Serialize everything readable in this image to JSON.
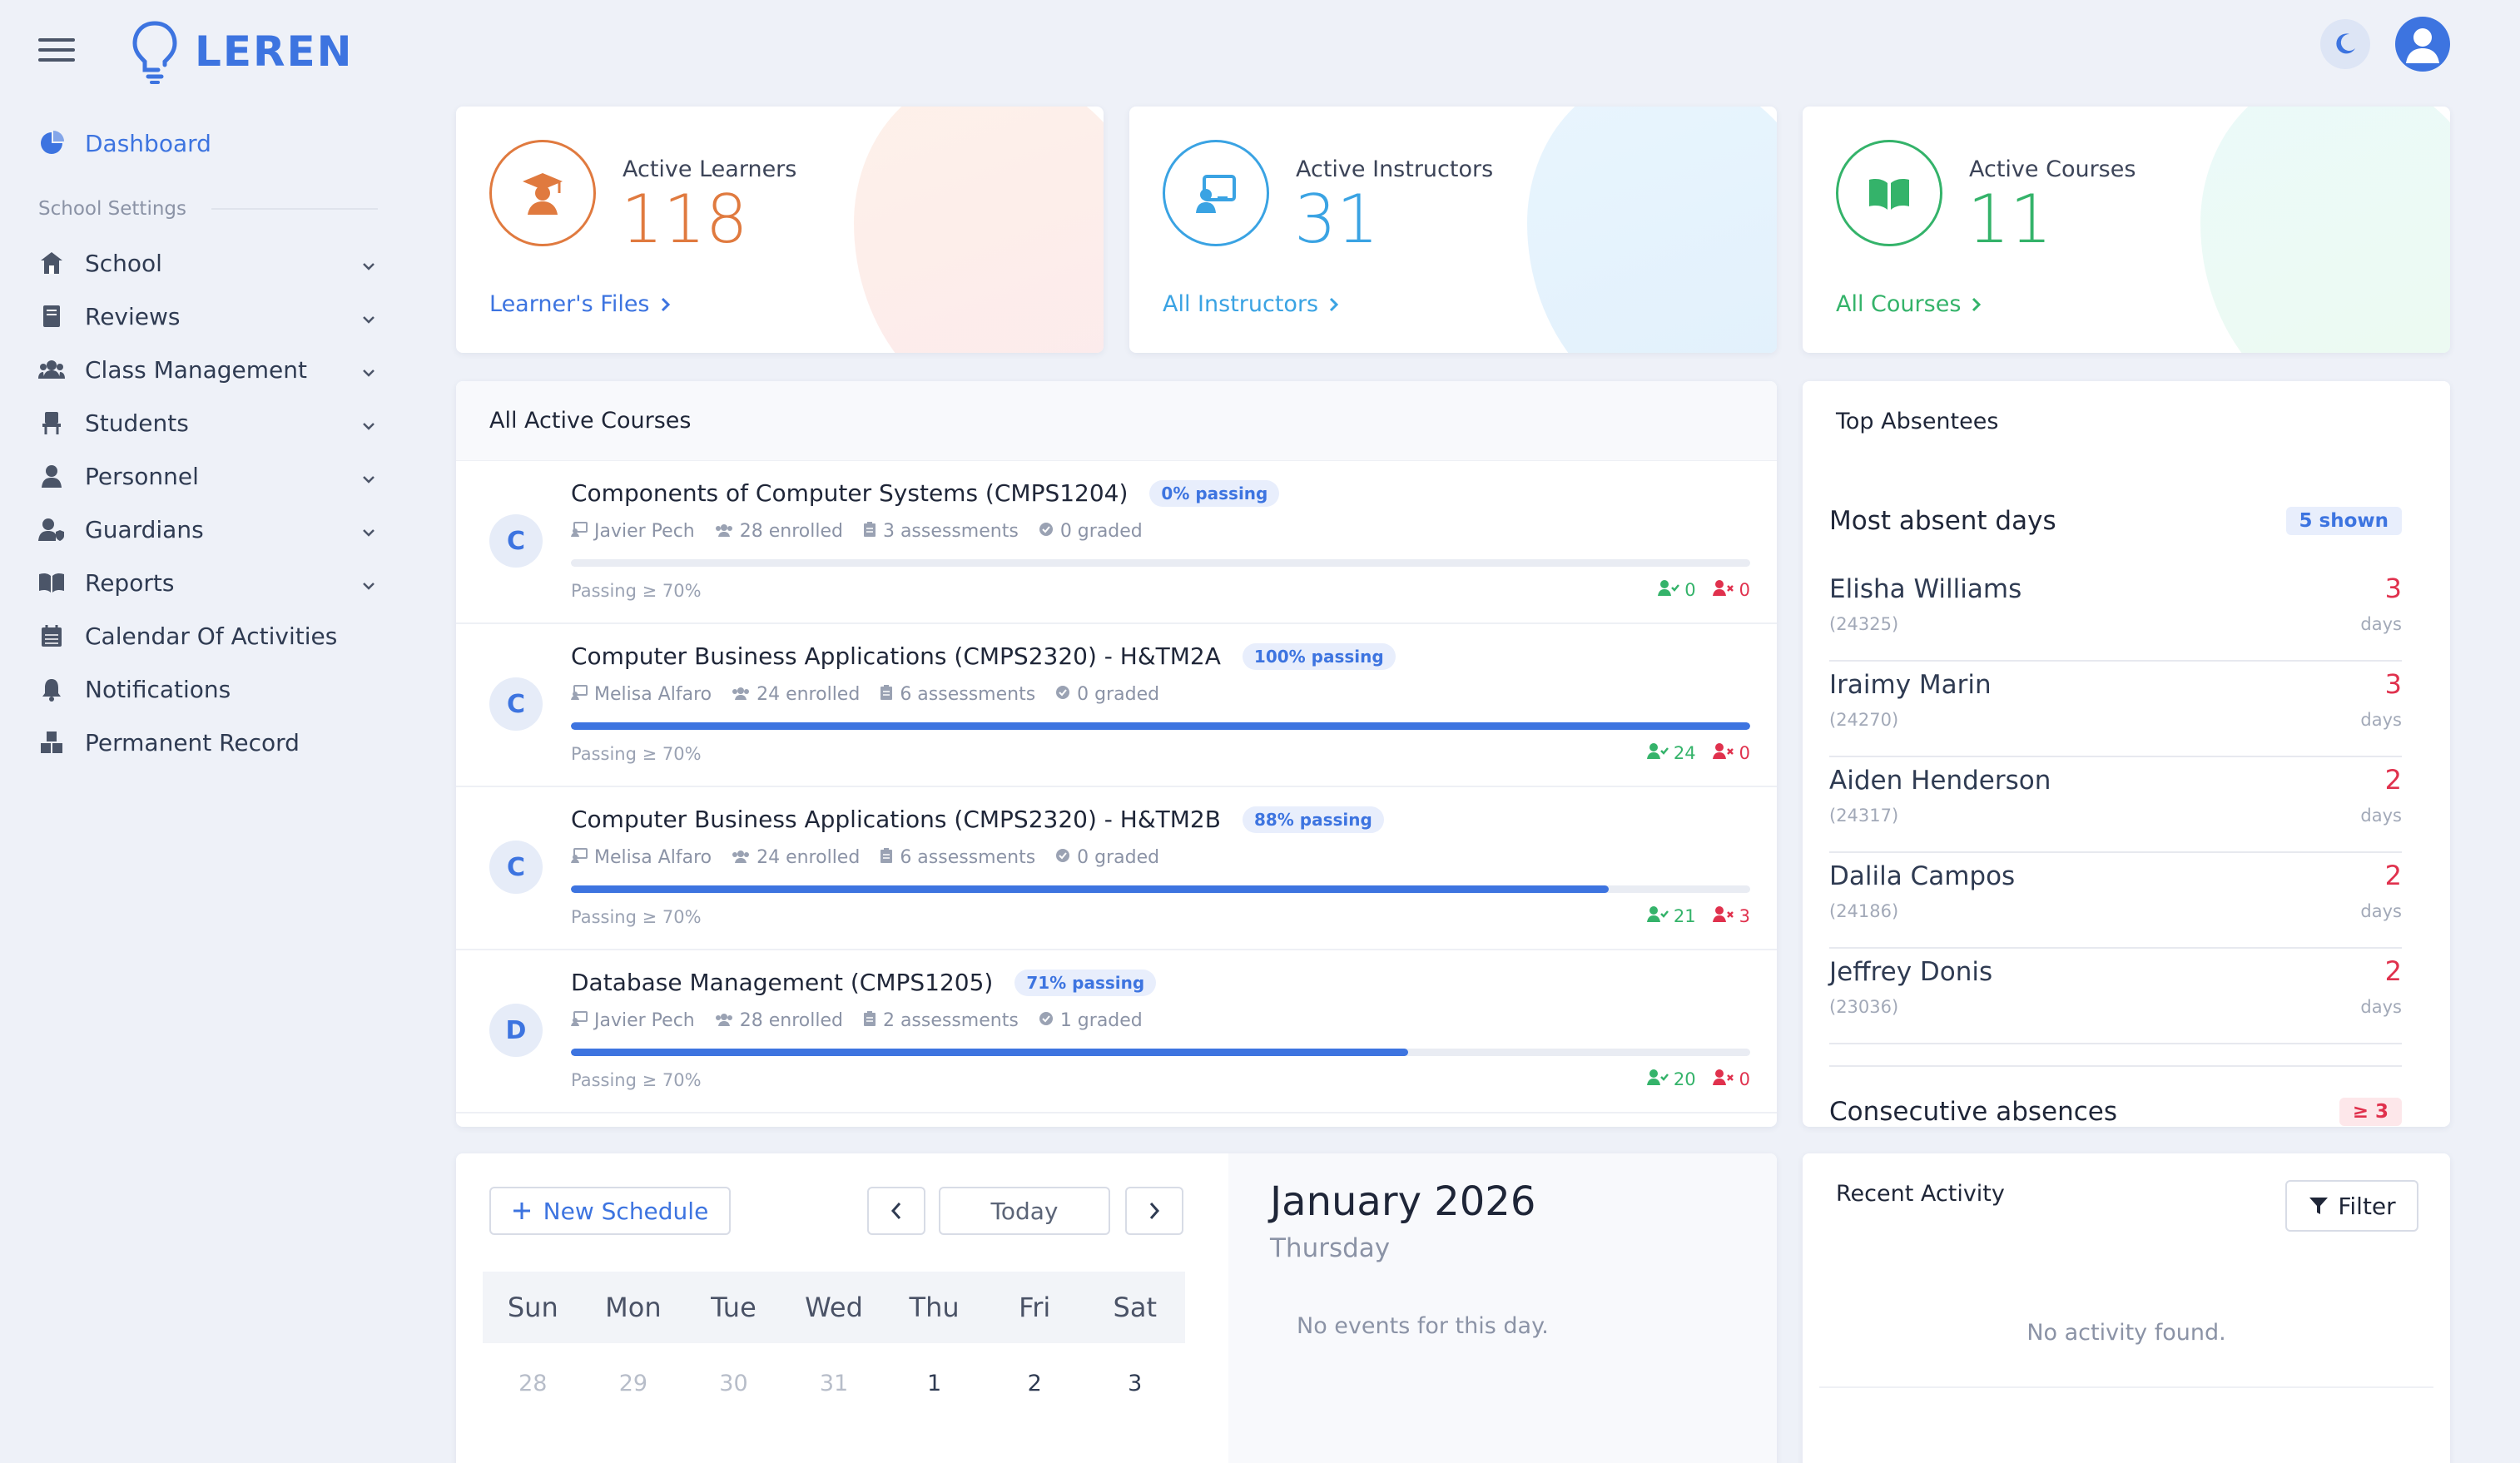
{
  "app": {
    "name": "LEREN"
  },
  "sidebar": {
    "dashboard": "Dashboard",
    "section_label": "School Settings",
    "items": [
      {
        "label": "School",
        "icon": "school-icon",
        "expandable": true
      },
      {
        "label": "Reviews",
        "icon": "book-icon",
        "expandable": true
      },
      {
        "label": "Class Management",
        "icon": "users-icon",
        "expandable": true
      },
      {
        "label": "Students",
        "icon": "chair-icon",
        "expandable": true
      },
      {
        "label": "Personnel",
        "icon": "person-icon",
        "expandable": true
      },
      {
        "label": "Guardians",
        "icon": "guardian-icon",
        "expandable": true
      },
      {
        "label": "Reports",
        "icon": "open-book-icon",
        "expandable": true
      },
      {
        "label": "Calendar Of Activities",
        "icon": "calendar-icon",
        "expandable": false
      },
      {
        "label": "Notifications",
        "icon": "bell-icon",
        "expandable": false
      },
      {
        "label": "Permanent Record",
        "icon": "boxes-icon",
        "expandable": false
      }
    ]
  },
  "stats": {
    "learners": {
      "label": "Active Learners",
      "value": "118",
      "link": "Learner's Files",
      "color": "#e07a3f"
    },
    "instructors": {
      "label": "Active Instructors",
      "value": "31",
      "link": "All Instructors",
      "color": "#3aa3e3"
    },
    "courses": {
      "label": "Active Courses",
      "value": "11",
      "link": "All Courses",
      "color": "#34b36a"
    }
  },
  "active_courses": {
    "title": "All Active Courses",
    "passing_label": "Passing ≥ 70%",
    "list": [
      {
        "avatar": "C",
        "title": "Components of Computer Systems (CMPS1204)",
        "badge": "0% passing",
        "instructor": "Javier Pech",
        "enrolled": "28 enrolled",
        "assessments": "3 assessments",
        "graded": "0 graded",
        "progress": 0,
        "passed": "0",
        "failed": "0"
      },
      {
        "avatar": "C",
        "title": "Computer Business Applications (CMPS2320) - H&TM2A",
        "badge": "100% passing",
        "instructor": "Melisa Alfaro",
        "enrolled": "24 enrolled",
        "assessments": "6 assessments",
        "graded": "0 graded",
        "progress": 100,
        "passed": "24",
        "failed": "0"
      },
      {
        "avatar": "C",
        "title": "Computer Business Applications (CMPS2320) - H&TM2B",
        "badge": "88% passing",
        "instructor": "Melisa Alfaro",
        "enrolled": "24 enrolled",
        "assessments": "6 assessments",
        "graded": "0 graded",
        "progress": 88,
        "passed": "21",
        "failed": "3"
      },
      {
        "avatar": "D",
        "title": "Database Management (CMPS1205)",
        "badge": "71% passing",
        "instructor": "Javier Pech",
        "enrolled": "28 enrolled",
        "assessments": "2 assessments",
        "graded": "1 graded",
        "progress": 71,
        "passed": "20",
        "failed": "0"
      }
    ]
  },
  "absentees": {
    "title": "Top Absentees",
    "section_title": "Most absent days",
    "shown": "5 shown",
    "unit": "days",
    "list": [
      {
        "name": "Elisha Williams",
        "id": "(24325)",
        "days": "3"
      },
      {
        "name": "Iraimy Marin",
        "id": "(24270)",
        "days": "3"
      },
      {
        "name": "Aiden Henderson",
        "id": "(24317)",
        "days": "2"
      },
      {
        "name": "Dalila Campos",
        "id": "(24186)",
        "days": "2"
      },
      {
        "name": "Jeffrey Donis",
        "id": "(23036)",
        "days": "2"
      }
    ],
    "consecutive_title": "Consecutive absences",
    "consecutive_badge": "≥ 3"
  },
  "calendar": {
    "new_schedule": "New Schedule",
    "today": "Today",
    "weekdays": [
      "Sun",
      "Mon",
      "Tue",
      "Wed",
      "Thu",
      "Fri",
      "Sat"
    ],
    "first_week": [
      {
        "day": "28",
        "muted": true
      },
      {
        "day": "29",
        "muted": true
      },
      {
        "day": "30",
        "muted": true
      },
      {
        "day": "31",
        "muted": true
      },
      {
        "day": "1",
        "muted": false
      },
      {
        "day": "2",
        "muted": false
      },
      {
        "day": "3",
        "muted": false
      }
    ],
    "month": "January 2026",
    "weekday_name": "Thursday",
    "no_events": "No events for this day."
  },
  "activity": {
    "title": "Recent Activity",
    "filter": "Filter",
    "empty": "No activity found."
  },
  "colors": {
    "accent": "#3d74e0",
    "success": "#34b36a",
    "danger": "#e0314d"
  }
}
